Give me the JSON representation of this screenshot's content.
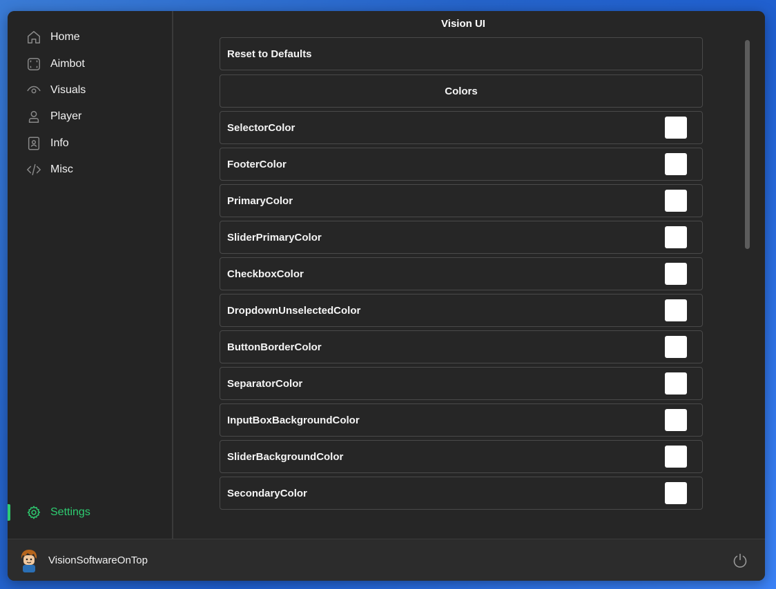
{
  "sidebar": {
    "items": [
      {
        "label": "Home",
        "icon": "home-icon"
      },
      {
        "label": "Aimbot",
        "icon": "crosshair-frame-icon"
      },
      {
        "label": "Visuals",
        "icon": "eye-icon"
      },
      {
        "label": "Player",
        "icon": "user-icon"
      },
      {
        "label": "Info",
        "icon": "contact-card-icon"
      },
      {
        "label": "Misc",
        "icon": "code-icon"
      }
    ],
    "settings": {
      "label": "Settings",
      "icon": "gear-icon",
      "active": true
    }
  },
  "main": {
    "title": "Vision UI",
    "reset_label": "Reset to Defaults",
    "section_header": "Colors",
    "colors": [
      {
        "label": "SelectorColor",
        "value": "#ffffff"
      },
      {
        "label": "FooterColor",
        "value": "#ffffff"
      },
      {
        "label": "PrimaryColor",
        "value": "#ffffff"
      },
      {
        "label": "SliderPrimaryColor",
        "value": "#ffffff"
      },
      {
        "label": "CheckboxColor",
        "value": "#ffffff"
      },
      {
        "label": "DropdownUnselectedColor",
        "value": "#ffffff"
      },
      {
        "label": "ButtonBorderColor",
        "value": "#ffffff"
      },
      {
        "label": "SeparatorColor",
        "value": "#ffffff"
      },
      {
        "label": "InputBoxBackgroundColor",
        "value": "#ffffff"
      },
      {
        "label": "SliderBackgroundColor",
        "value": "#ffffff"
      },
      {
        "label": "SecondaryColor",
        "value": "#ffffff"
      }
    ]
  },
  "footer": {
    "username": "VisionSoftwareOnTop",
    "avatar_icon": "avatar-icon",
    "power_icon": "power-icon"
  },
  "theme": {
    "accent": "#2ecc71",
    "background": "#262626",
    "text": "#f5f5f5"
  }
}
